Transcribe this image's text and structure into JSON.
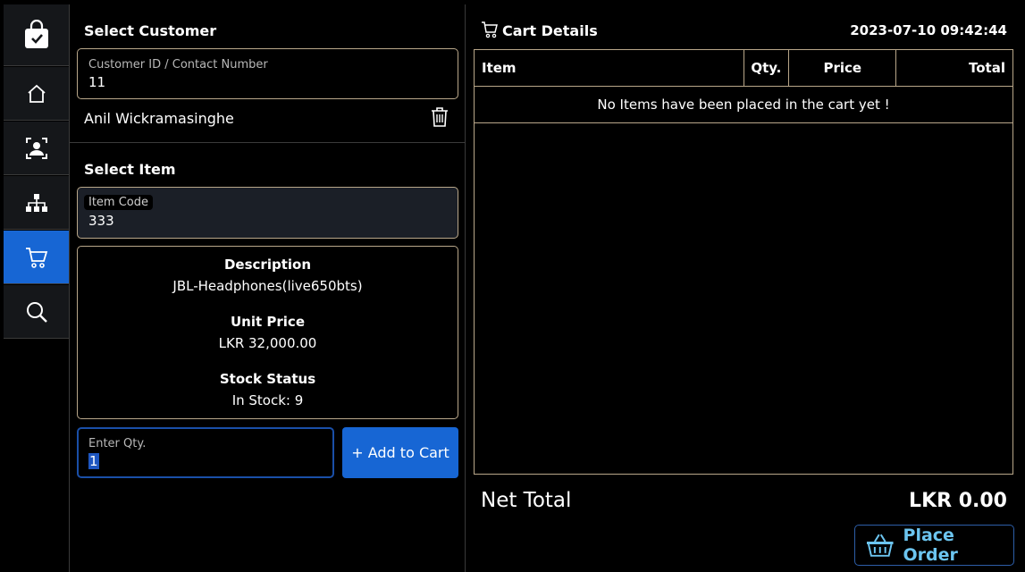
{
  "sidebar": {
    "items": [
      {
        "icon": "shopping-bag-check-icon"
      },
      {
        "icon": "home-icon"
      },
      {
        "icon": "customer-icon"
      },
      {
        "icon": "hierarchy-icon"
      },
      {
        "icon": "cart-icon",
        "active": true
      },
      {
        "icon": "search-icon"
      }
    ]
  },
  "customer": {
    "section_title": "Select Customer",
    "field_label": "Customer ID / Contact Number",
    "field_value": "11",
    "name": "Anil Wickramasinghe"
  },
  "item": {
    "section_title": "Select Item",
    "field_label": "Item Code",
    "field_value": "333",
    "description_label": "Description",
    "description": "JBL-Headphones(live650bts)",
    "unit_price_label": "Unit Price",
    "unit_price": "LKR 32,000.00",
    "stock_label": "Stock Status",
    "stock": "In Stock: 9"
  },
  "qty": {
    "label": "Enter Qty.",
    "value": "1",
    "add_button": "+ Add to Cart"
  },
  "cart": {
    "title": "Cart Details",
    "datetime": "2023-07-10 09:42:44",
    "columns": [
      "Item",
      "Qty.",
      "Price",
      "Total"
    ],
    "empty_message": "No Items have been placed in the cart yet !",
    "net_total_label": "Net Total",
    "net_total": "LKR 0.00",
    "place_order": "Place Order"
  },
  "colors": {
    "accent": "#1766d4",
    "border": "#b9a78a",
    "place_order_text": "#6cc5f0"
  }
}
